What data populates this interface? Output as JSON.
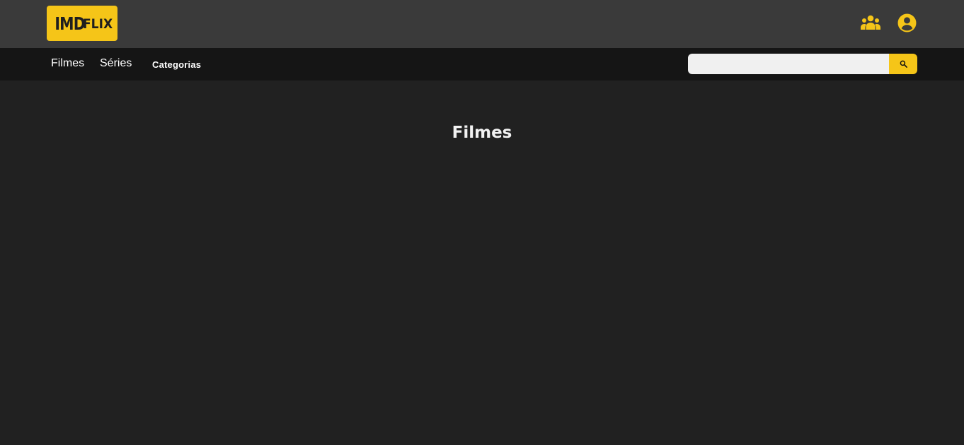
{
  "header": {
    "logo": {
      "part_a": "IMD",
      "part_b": "FLIX"
    },
    "icons": [
      "group-icon",
      "account-circle-icon"
    ]
  },
  "nav": {
    "items": [
      {
        "label": "Filmes"
      },
      {
        "label": "Séries"
      },
      {
        "label": "Categorias"
      }
    ]
  },
  "search": {
    "value": "",
    "placeholder": "",
    "button_icon": "search-icon"
  },
  "main": {
    "title": "Filmes"
  },
  "colors": {
    "accent": "#f5c518",
    "topbar": "#3a3a3a",
    "navbar": "#151515",
    "background": "#212121"
  }
}
